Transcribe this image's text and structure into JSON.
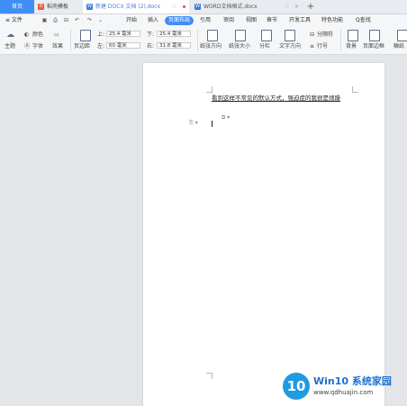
{
  "tabs": {
    "home": "首页",
    "t1": "稻壳模板",
    "t2": "新建 DOCX 文档 (2).docx",
    "t3": "WORD文档格式.docx",
    "new_tab": "+"
  },
  "menu": {
    "file": "≡ 文件",
    "items": [
      "开始",
      "插入",
      "页面布局",
      "引用",
      "审阅",
      "视图",
      "章节",
      "开发工具",
      "特色功能"
    ],
    "active": "页面布局",
    "search": "Q查找"
  },
  "ribbon": {
    "theme": "主题",
    "color": "颜色",
    "font": "字体",
    "effect": "效果",
    "margin": "页边距",
    "top_label": "上:",
    "top_val": "25.4 毫米",
    "bottom_label": "下:",
    "bottom_val": "25.4 毫米",
    "left_label": "左:",
    "left_val": "60 毫米",
    "right_label": "右:",
    "right_val": "31.8 毫米",
    "orientation": "纸张方向",
    "size": "纸张大小",
    "columns": "分栏",
    "text_dir": "文字方向",
    "breaks": "分隔符",
    "line_no": "行号",
    "background": "背景",
    "border": "页面边框",
    "watermark": "稿纸"
  },
  "document": {
    "text": "看到这样不常见的默认方式，强迫症的我很是烦躁"
  },
  "watermark": {
    "logo": "10",
    "brand": "Win10 系统家园",
    "url": "www.qdhuajin.com"
  }
}
